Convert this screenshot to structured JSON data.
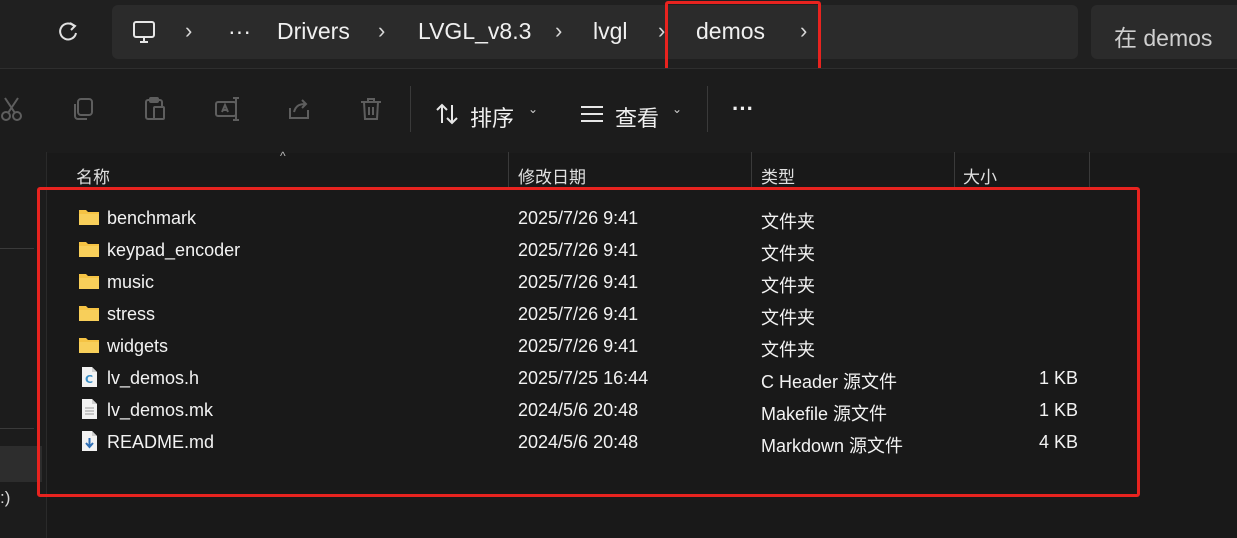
{
  "breadcrumb": {
    "overflow": "···",
    "items": [
      "Drivers",
      "LVGL_v8.3",
      "lvgl",
      "demos"
    ]
  },
  "search": {
    "placeholder": "在 demos 中搜索",
    "visible_text": "在 demos"
  },
  "toolbar": {
    "sort_label": "排序",
    "view_label": "查看",
    "more_label": "···"
  },
  "columns": {
    "name": "名称",
    "modified": "修改日期",
    "type": "类型",
    "size": "大小"
  },
  "files": [
    {
      "name": "benchmark",
      "modified": "2025/7/26 9:41",
      "type": "文件夹",
      "size": "",
      "icon": "folder-icon"
    },
    {
      "name": "keypad_encoder",
      "modified": "2025/7/26 9:41",
      "type": "文件夹",
      "size": "",
      "icon": "folder-icon"
    },
    {
      "name": "music",
      "modified": "2025/7/26 9:41",
      "type": "文件夹",
      "size": "",
      "icon": "folder-icon"
    },
    {
      "name": "stress",
      "modified": "2025/7/26 9:41",
      "type": "文件夹",
      "size": "",
      "icon": "folder-icon"
    },
    {
      "name": "widgets",
      "modified": "2025/7/26 9:41",
      "type": "文件夹",
      "size": "",
      "icon": "folder-icon"
    },
    {
      "name": "lv_demos.h",
      "modified": "2025/7/25 16:44",
      "type": "C Header 源文件",
      "size": "1 KB",
      "icon": "c-header-file-icon"
    },
    {
      "name": "lv_demos.mk",
      "modified": "2024/5/6 20:48",
      "type": "Makefile 源文件",
      "size": "1 KB",
      "icon": "text-file-icon"
    },
    {
      "name": "README.md",
      "modified": "2024/5/6 20:48",
      "type": "Markdown 源文件",
      "size": "4 KB",
      "icon": "markdown-file-icon"
    }
  ],
  "nav": {
    "partial_text": ":)"
  },
  "colors": {
    "highlight": "#e8231f",
    "folder": "#f5c344",
    "background": "#191919"
  }
}
